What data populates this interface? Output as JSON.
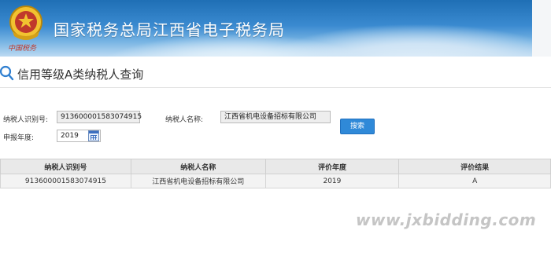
{
  "header": {
    "emblem_caption": "中国税务",
    "site_title": "国家税务总局江西省电子税务局"
  },
  "page": {
    "title": "信用等级A类纳税人查询"
  },
  "form": {
    "taxpayer_id_label": "纳税人识别号:",
    "taxpayer_id_value": "913600001583074915",
    "taxpayer_name_label": "纳税人名称:",
    "taxpayer_name_value": "江西省机电设备招标有限公司",
    "year_label": "申报年度:",
    "year_value": "2019",
    "search_label": "搜索"
  },
  "table": {
    "headers": [
      "纳税人识别号",
      "纳税人名称",
      "评价年度",
      "评价结果"
    ],
    "rows": [
      [
        "913600001583074915",
        "江西省机电设备招标有限公司",
        "2019",
        "A"
      ]
    ]
  },
  "watermark": "www.jxbidding.com",
  "colors": {
    "banner_top": "#1f6fb5",
    "button": "#2f89d8",
    "header_row": "#e9e9e9"
  },
  "icons": {
    "emblem": "tax-emblem-icon",
    "search": "search-icon",
    "calendar": "calendar-icon"
  }
}
